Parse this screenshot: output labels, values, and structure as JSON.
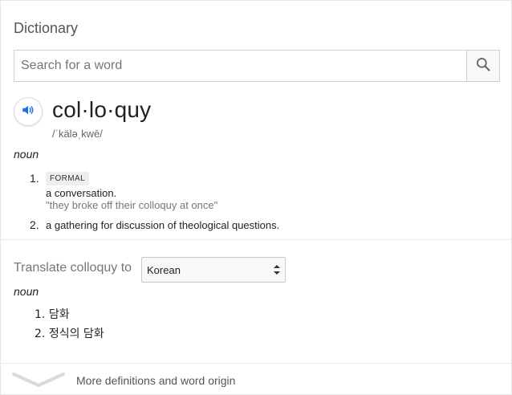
{
  "header": {
    "title": "Dictionary"
  },
  "search": {
    "placeholder": "Search for a word",
    "value": ""
  },
  "entry": {
    "word": "col·lo·quy",
    "phonetic": "/ˈkäləˌkwē/",
    "part_of_speech": "noun",
    "senses": [
      {
        "number": "1.",
        "label": "FORMAL",
        "definition": "a conversation.",
        "example": "\"they broke off their colloquy at once\""
      },
      {
        "number": "2.",
        "definition": "a gathering for discussion of theological questions."
      }
    ]
  },
  "translate": {
    "label": "Translate colloquy to",
    "selected_language": "Korean",
    "part_of_speech": "noun",
    "items": [
      {
        "number": "1.",
        "text": "담화"
      },
      {
        "number": "2.",
        "text": "정식의 담화"
      }
    ]
  },
  "footer": {
    "more_label": "More definitions and word origin"
  },
  "colors": {
    "accent": "#1a73e8",
    "muted": "#757575",
    "divider": "#ebebeb"
  },
  "icons": {
    "search": "search-icon",
    "audio": "speaker-icon",
    "expand": "chevron-down-icon"
  }
}
